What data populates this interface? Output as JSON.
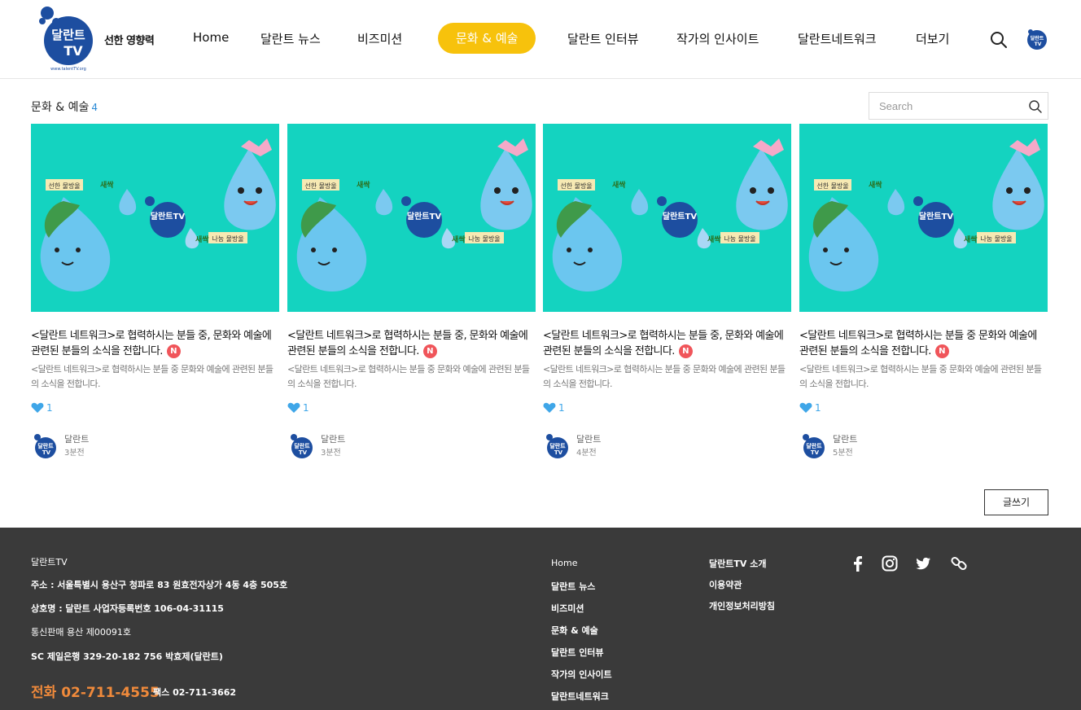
{
  "header": {
    "logo_alt": "달란트TV",
    "slogan": "선한 영향력",
    "nav": [
      {
        "label": "Home"
      },
      {
        "label": "달란트 뉴스"
      },
      {
        "label": "비즈미션"
      },
      {
        "label": "문화 & 예술",
        "active": true
      },
      {
        "label": "달란트 인터뷰"
      },
      {
        "label": "작가의 인사이트"
      },
      {
        "label": "달란트네트워크"
      },
      {
        "label": "더보기"
      }
    ],
    "search_icon": "search-icon",
    "avatar_icon": "user-avatar-icon"
  },
  "section": {
    "title": "문화 & 예술",
    "count": "4",
    "search_placeholder": "Search"
  },
  "posts": [
    {
      "title": "<달란트 네트워크>로 협력하시는 분들 중, 문화와 예술에 관련된 분들의 소식을 전합니다.",
      "badge": "N",
      "desc": "<달란트 네트워크>로 협력하시는 분들 중 문화와 예술에 관련된 분들의 소식을 전합니다.",
      "likes": "1",
      "author": "달란트",
      "time": "3분전"
    },
    {
      "title": "<달란트 네트워크>로 협력하시는 분들 중, 문화와 예술에 관련된 분들의 소식을 전합니다.",
      "badge": "N",
      "desc": "<달란트 네트워크>로 협력하시는 분들 중 문화와 예술에 관련된 분들의 소식을 전합니다.",
      "likes": "1",
      "author": "달란트",
      "time": "3분전"
    },
    {
      "title": "<달란트 네트워크>로 협력하시는 분들 중, 문화와 예술에 관련된 분들의 소식을 전합니다.",
      "badge": "N",
      "desc": "<달란트 네트워크>로 협력하시는 분들 중 문화와 예술에 관련된 분들의 소식을 전합니다.",
      "likes": "1",
      "author": "달란트",
      "time": "4분전"
    },
    {
      "title": "<달란트 네트워크>로 협력하시는 분들 중 문화와 예술에 관련된 분들의 소식을 전합니다.",
      "badge": "N",
      "desc": "<달란트 네트워크>로 협력하시는 분들 중 문화와 예술에 관련된 분들의 소식을 전합니다.",
      "likes": "1",
      "author": "달란트",
      "time": "5분전"
    }
  ],
  "thumbnail": {
    "label_left": "선한 물방울",
    "label_right": "나눔 물방울",
    "brand": "달란트TV",
    "sprout": "새싹"
  },
  "write_button": "글쓰기",
  "footer": {
    "company": "달란트TV",
    "address": "주소 : 서울특별시 용산구 청파로 83 원효전자상가 4동 4층 505호",
    "business": "상호명 : 달란트  사업자등록번호 106-04-31115",
    "mail_order": "통신판매  용산 제00091호",
    "bank": "SC 제일은행  329-20-182 756 박효제(달란트)",
    "phone": "전화 02-711-4555",
    "fax": "팩스 02-711-3662",
    "links_col1": [
      "Home",
      "달란트 뉴스",
      "비즈미션",
      "문화 & 예술",
      "달란트 인터뷰",
      "작가의 인사이트",
      "달란트네트워크"
    ],
    "links_col2": [
      "달란트TV 소개",
      "이용약관",
      "개인정보처리방침"
    ],
    "social": [
      "facebook-icon",
      "instagram-icon",
      "twitter-icon",
      "link-icon"
    ]
  },
  "colors": {
    "accent": "#f7c20c",
    "thumb_bg": "#14d3c0",
    "badge": "#f0555a",
    "like": "#3fa6e8",
    "footer_bg": "#3a3a3a",
    "phone": "#f08a3b"
  }
}
